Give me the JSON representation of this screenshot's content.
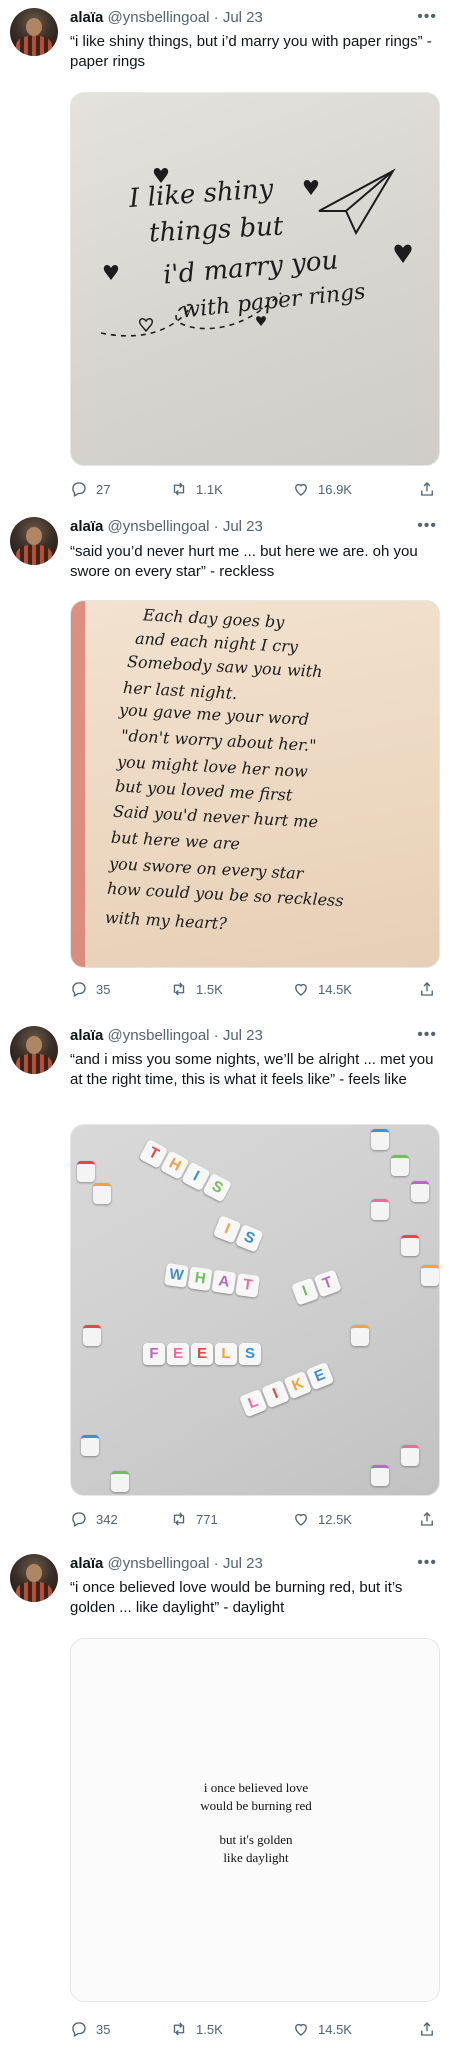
{
  "tweets": [
    {
      "name": "alaïa",
      "handle": "@ynsbellingoal",
      "date": "Jul 23",
      "text": "“i like shiny things, but i’d marry you with paper rings” - paper rings",
      "image_text": [
        "I like shiny",
        "things but",
        "i'd marry you",
        "with paper rings"
      ],
      "replies": "27",
      "retweets": "1.1K",
      "likes": "16.9K"
    },
    {
      "name": "alaïa",
      "handle": "@ynsbellingoal",
      "date": "Jul 23",
      "text": "“said you’d never hurt me ... but here we are. oh you swore on every star” - reckless",
      "image_text": [
        "Each day goes by",
        "and each night I cry",
        "Somebody saw you with",
        "her last night.",
        "you gave me your word",
        "\"don't worry about her.\"",
        "you might love her now",
        "but you loved me first",
        "Said you'd never hurt me",
        "but here we are",
        "you swore on every star",
        "how could you be so reckless",
        "with my heart?"
      ],
      "replies": "35",
      "retweets": "1.5K",
      "likes": "14.5K"
    },
    {
      "name": "alaïa",
      "handle": "@ynsbellingoal",
      "date": "Jul 23",
      "text": "“and i miss you some nights, we’ll be alright ... met you at the right time, this is what it feels like” - feels like",
      "image_words": [
        "THIS",
        "IS",
        "WHAT",
        "IT",
        "FEELS",
        "LIKE"
      ],
      "replies": "342",
      "retweets": "771",
      "likes": "12.5K"
    },
    {
      "name": "alaïa",
      "handle": "@ynsbellingoal",
      "date": "Jul 23",
      "text": "“i once believed love would be burning red, but it’s golden ... like daylight” - daylight",
      "image_text": [
        "i once believed love",
        "would be burning red",
        "but it's golden",
        "like daylight"
      ],
      "replies": "35",
      "retweets": "1.5K",
      "likes": "14.5K"
    }
  ],
  "ui": {
    "separator": "·",
    "more_label": "•••"
  },
  "colors": {
    "text": "#0f1419",
    "secondary": "#536471",
    "paper": "#d9d7d2",
    "lined_paper": "#efdcc7"
  },
  "icons": [
    "reply-icon",
    "retweet-icon",
    "like-icon",
    "share-icon"
  ]
}
